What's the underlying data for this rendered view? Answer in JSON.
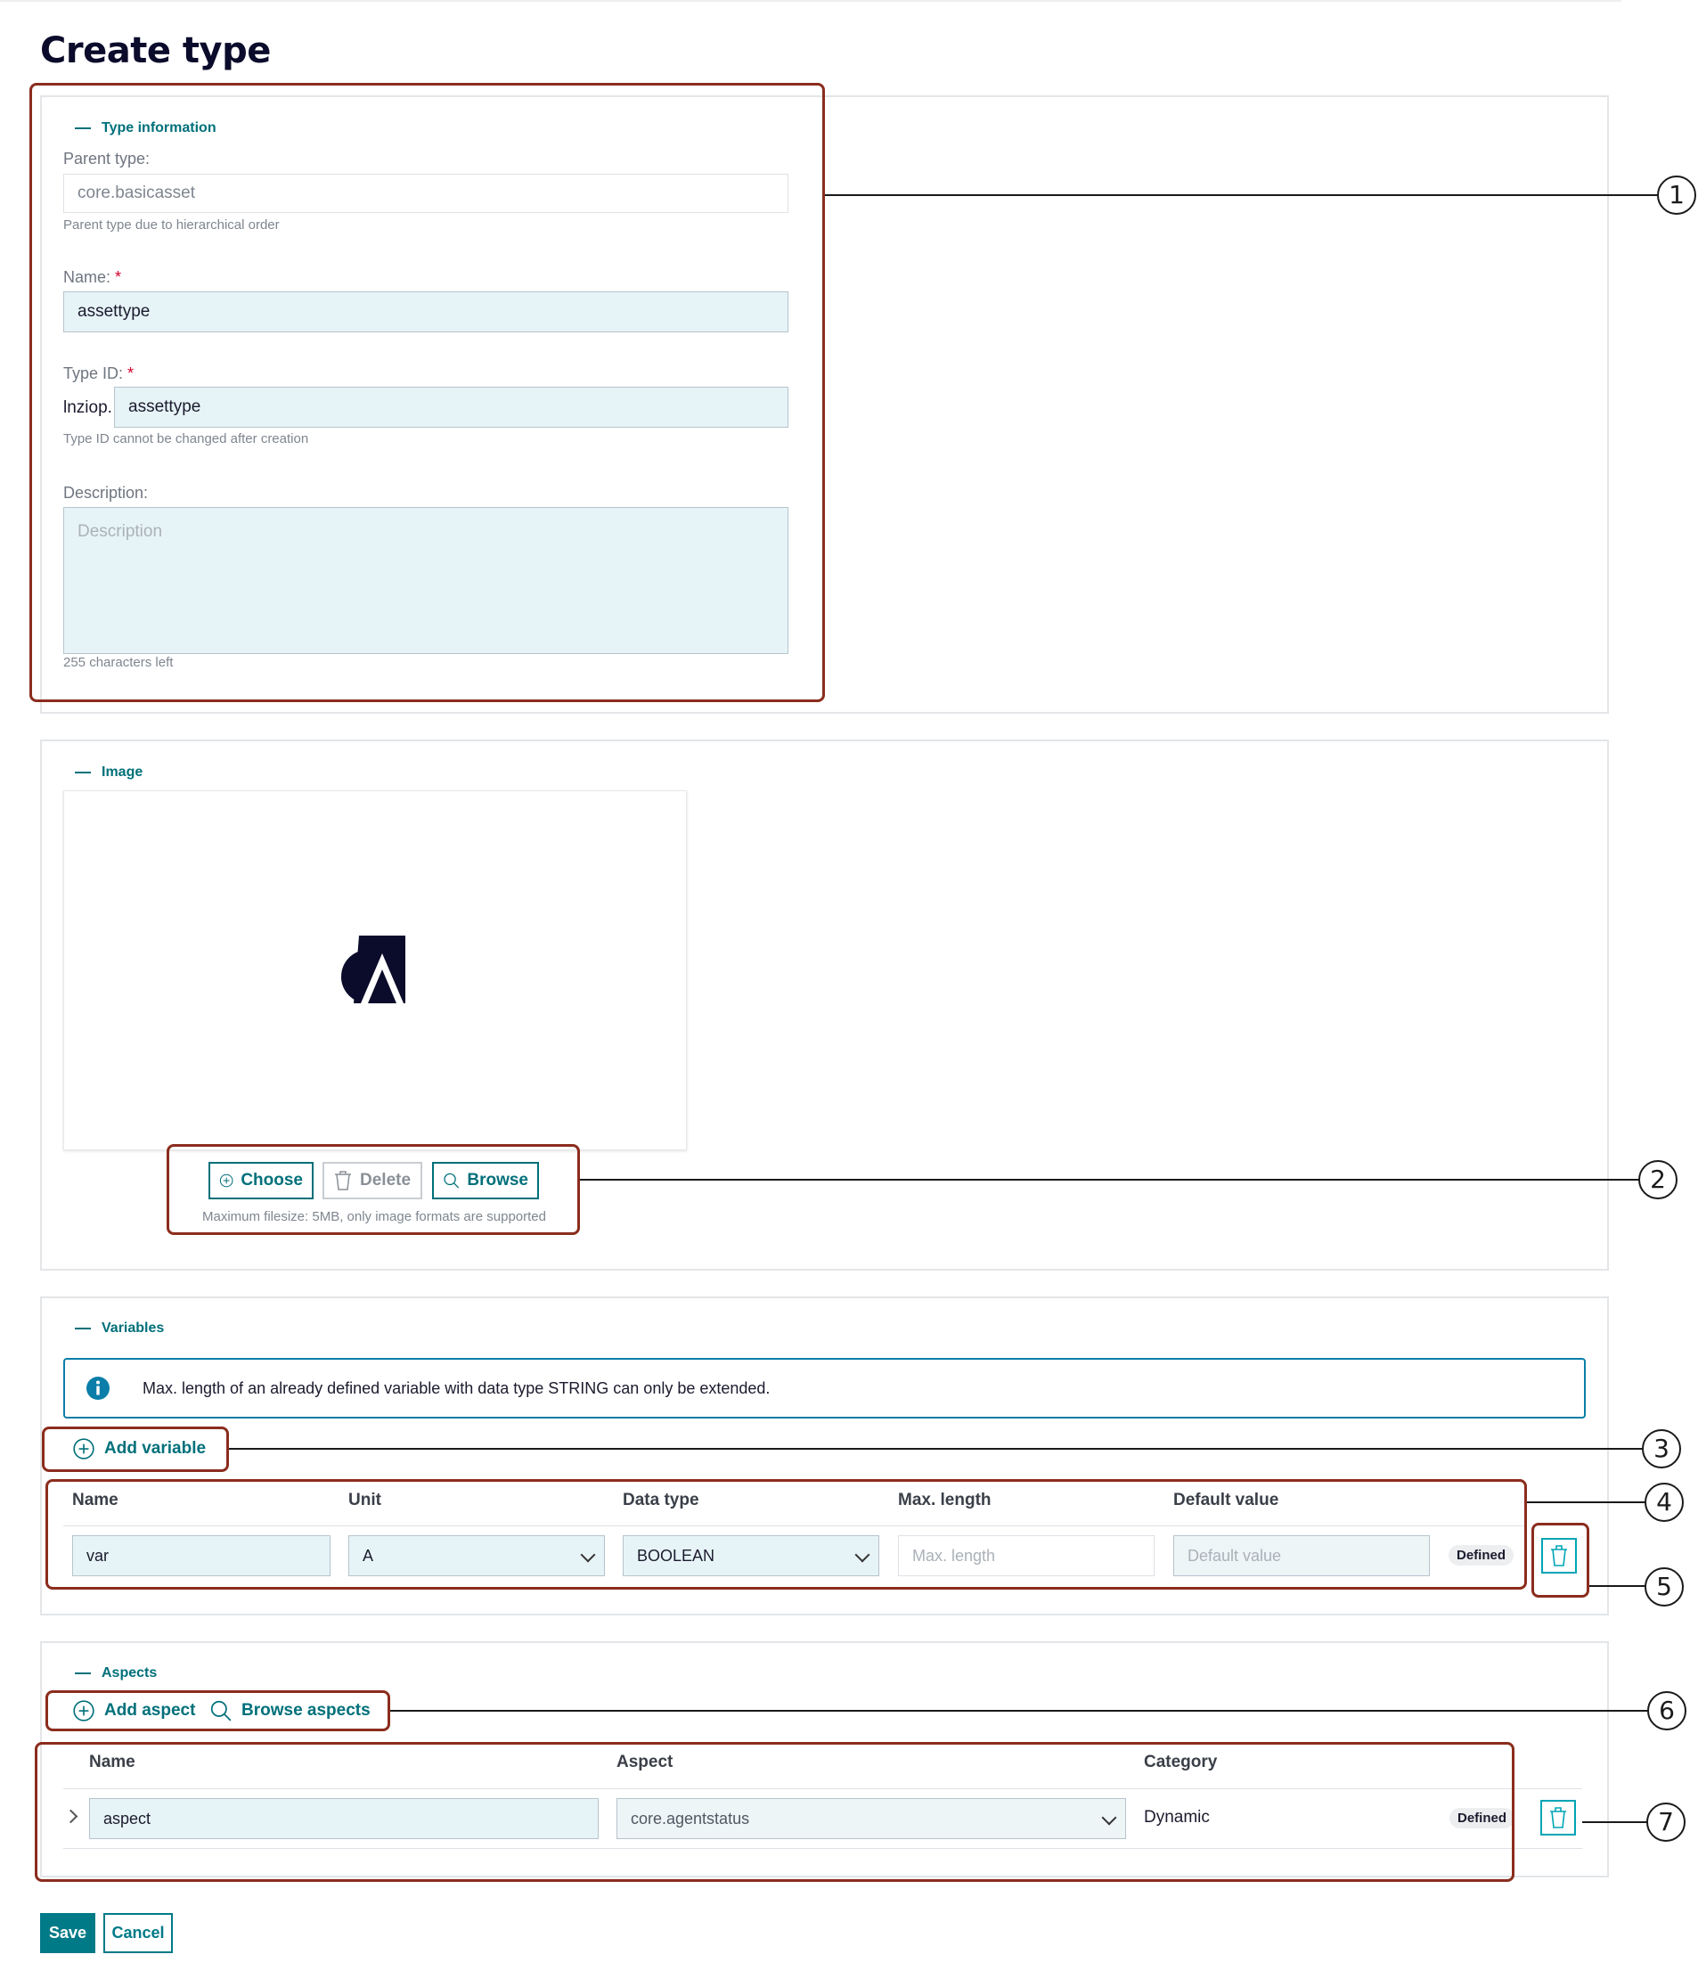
{
  "page": {
    "title": "Create type"
  },
  "type_information": {
    "section_title": "Type information",
    "parent_type": {
      "label": "Parent type:",
      "value": "core.basicasset",
      "help": "Parent type due to hierarchical order"
    },
    "name": {
      "label": "Name:",
      "required": "*",
      "value": "assettype"
    },
    "type_id": {
      "label": "Type ID:",
      "required": "*",
      "prefix": "lnziop.",
      "value": "assettype",
      "help": "Type ID cannot be changed after creation"
    },
    "description": {
      "label": "Description:",
      "placeholder": "Description",
      "help": "255 characters left"
    }
  },
  "image": {
    "section_title": "Image",
    "logo_icon": "asset-logo-icon",
    "buttons": {
      "choose": "Choose",
      "delete": "Delete",
      "browse": "Browse"
    },
    "help": "Maximum filesize: 5MB, only image formats are supported"
  },
  "variables": {
    "section_title": "Variables",
    "info": "Max. length of an already defined variable with data type STRING can only be extended.",
    "add_label": "Add variable",
    "columns": {
      "name": "Name",
      "unit": "Unit",
      "data_type": "Data type",
      "max_length": "Max. length",
      "default_value": "Default value"
    },
    "row": {
      "name": "var",
      "unit": "A",
      "data_type": "BOOLEAN",
      "max_length_placeholder": "Max. length",
      "default_value_placeholder": "Default value",
      "badge": "Defined"
    }
  },
  "aspects": {
    "section_title": "Aspects",
    "add_label": "Add aspect",
    "browse_label": "Browse aspects",
    "columns": {
      "name": "Name",
      "aspect": "Aspect",
      "category": "Category"
    },
    "row": {
      "name": "aspect",
      "aspect": "core.agentstatus",
      "category": "Dynamic",
      "badge": "Defined"
    }
  },
  "footer": {
    "save": "Save",
    "cancel": "Cancel"
  },
  "callouts": [
    "1",
    "2",
    "3",
    "4",
    "5",
    "6",
    "7"
  ],
  "colors": {
    "accent": "#00707a",
    "primary_button": "#007a87",
    "callout_frame": "#8b2d1d",
    "field_bg": "#e7f4f7",
    "required": "#d4002a",
    "info_border": "#0a7ea8"
  }
}
